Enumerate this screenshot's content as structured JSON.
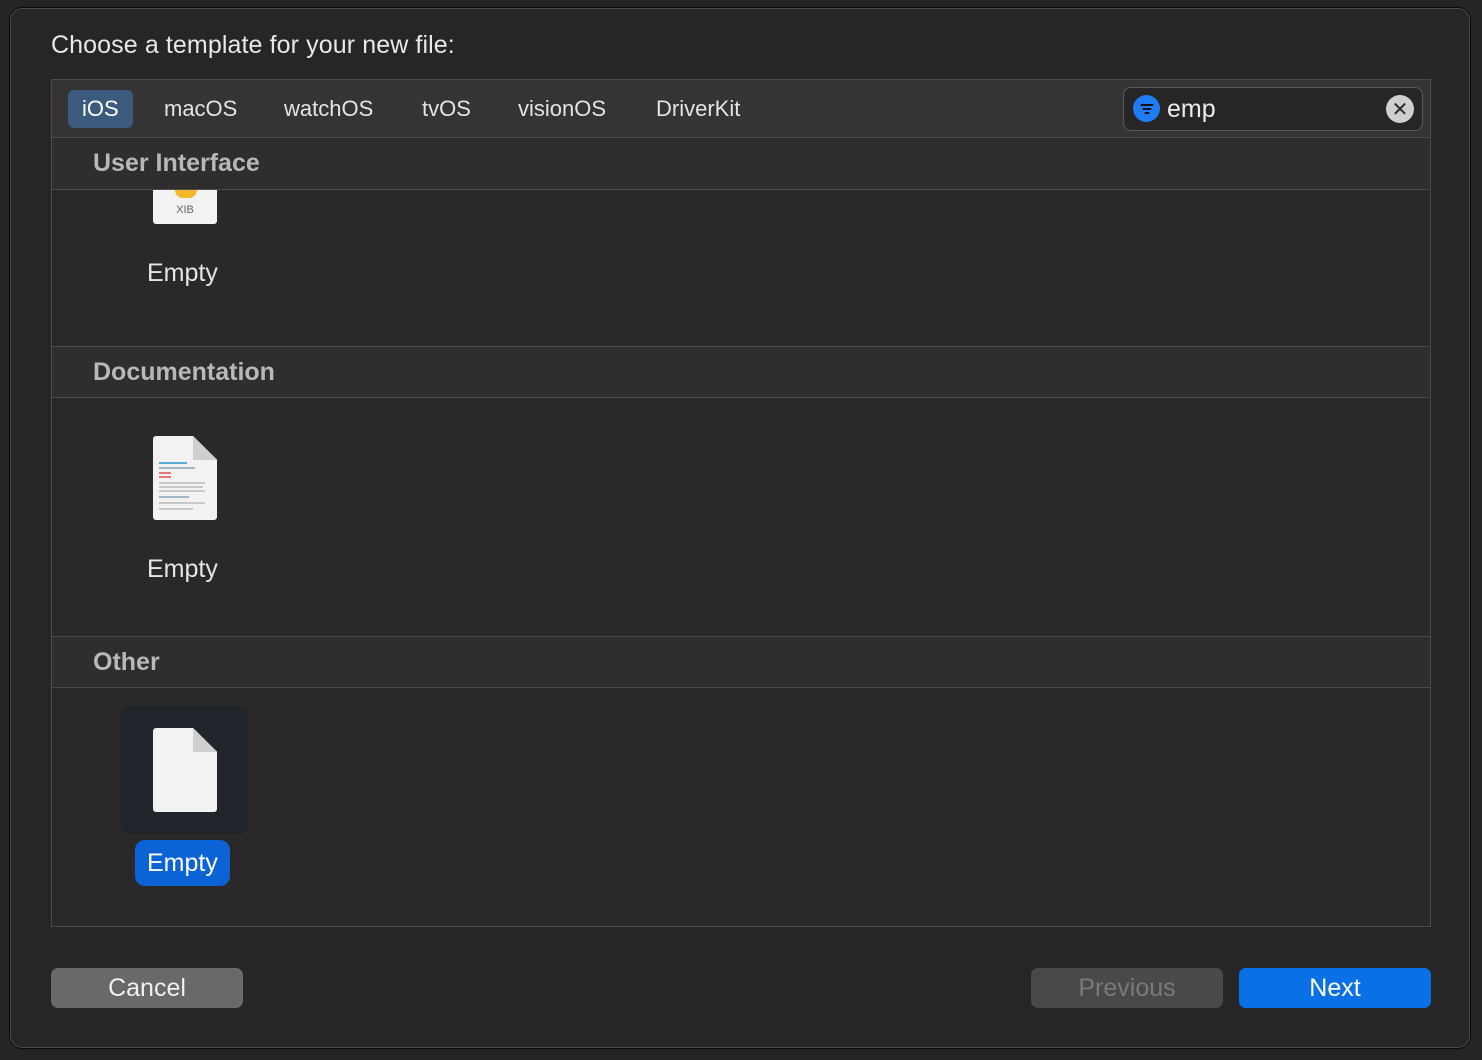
{
  "dialog": {
    "title": "Choose a template for your new file:"
  },
  "platform_tabs": [
    {
      "label": "iOS",
      "active": true
    },
    {
      "label": "macOS",
      "active": false
    },
    {
      "label": "watchOS",
      "active": false
    },
    {
      "label": "tvOS",
      "active": false
    },
    {
      "label": "visionOS",
      "active": false
    },
    {
      "label": "DriverKit",
      "active": false
    }
  ],
  "search": {
    "value": "emp",
    "filter_icon": "filter-icon",
    "clear_icon": "clear-icon"
  },
  "sections": [
    {
      "title": "User Interface",
      "templates": [
        {
          "label": "Empty",
          "icon": "xib-file-icon",
          "icon_text": "XIB",
          "selected": false
        }
      ]
    },
    {
      "title": "Documentation",
      "templates": [
        {
          "label": "Empty",
          "icon": "documentation-file-icon",
          "selected": false
        }
      ]
    },
    {
      "title": "Other",
      "templates": [
        {
          "label": "Empty",
          "icon": "blank-file-icon",
          "selected": true
        }
      ]
    }
  ],
  "buttons": {
    "cancel": "Cancel",
    "previous": "Previous",
    "next": "Next"
  },
  "colors": {
    "accent": "#0a70e6",
    "selected_tab": "#3b5a7d",
    "sheet_background": "#272525"
  }
}
